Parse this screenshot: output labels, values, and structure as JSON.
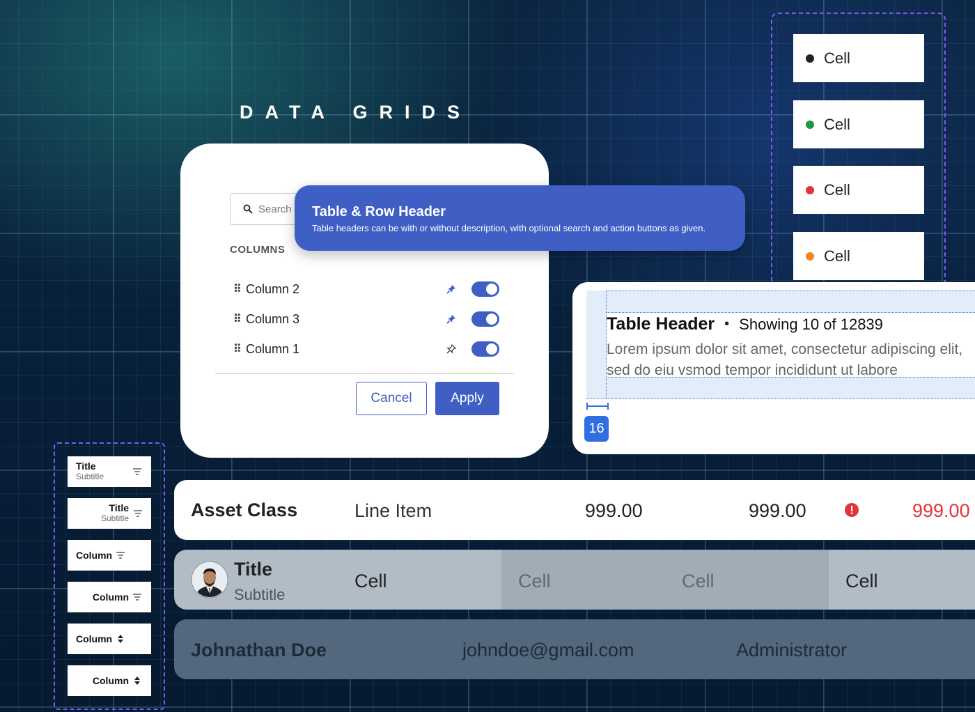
{
  "page": {
    "title": "DATA GRIDS"
  },
  "settings": {
    "search_placeholder": "Search",
    "columns_heading": "COLUMNS",
    "columns": [
      {
        "label": "Column 2",
        "pinned": true,
        "enabled": true
      },
      {
        "label": "Column 3",
        "pinned": true,
        "enabled": true
      },
      {
        "label": "Column 1",
        "pinned": false,
        "enabled": true
      }
    ],
    "cancel_label": "Cancel",
    "apply_label": "Apply"
  },
  "tooltip": {
    "title": "Table & Row Header",
    "description": "Table headers can be with or without description, with optional search and action buttons as given."
  },
  "status_cells": [
    {
      "label": "Cell",
      "color": "#222222"
    },
    {
      "label": "Cell",
      "color": "#1e9a3c"
    },
    {
      "label": "Cell",
      "color": "#e5333a"
    },
    {
      "label": "Cell",
      "color": "#f0852a"
    }
  ],
  "table_header": {
    "title": "Table Header",
    "separator": "•",
    "count": "Showing 10 of 12839",
    "description_line1": "Lorem ipsum dolor sit amet, consectetur adipiscing elit,",
    "description_line2": "sed do eiu vsmod tempor incididunt ut labore",
    "spacing_value": "16"
  },
  "header_variants": [
    {
      "title": "Title",
      "subtitle": "Subtitle",
      "icon": "filter-icon",
      "align": "left"
    },
    {
      "title": "Title",
      "subtitle": "Subtitle",
      "icon": "filter-icon",
      "align": "right"
    },
    {
      "title": "Column",
      "icon": "filter-icon",
      "align": "left"
    },
    {
      "title": "Column",
      "icon": "filter-icon",
      "align": "right"
    },
    {
      "title": "Column",
      "icon": "sort-icon",
      "align": "left"
    },
    {
      "title": "Column",
      "icon": "sort-icon",
      "align": "right"
    }
  ],
  "rows": {
    "asset": {
      "title": "Asset Class",
      "line_item": "Line Item",
      "value1": "999.00",
      "value2": "999.00",
      "value3": "999.00",
      "alert_color": "#e5333a"
    },
    "person": {
      "title": "Title",
      "subtitle": "Subtitle",
      "cells": [
        "Cell",
        "Cell",
        "Cell",
        "Cell"
      ]
    },
    "user": {
      "name": "Johnathan Doe",
      "email": "johndoe@gmail.com",
      "role": "Administrator"
    }
  }
}
